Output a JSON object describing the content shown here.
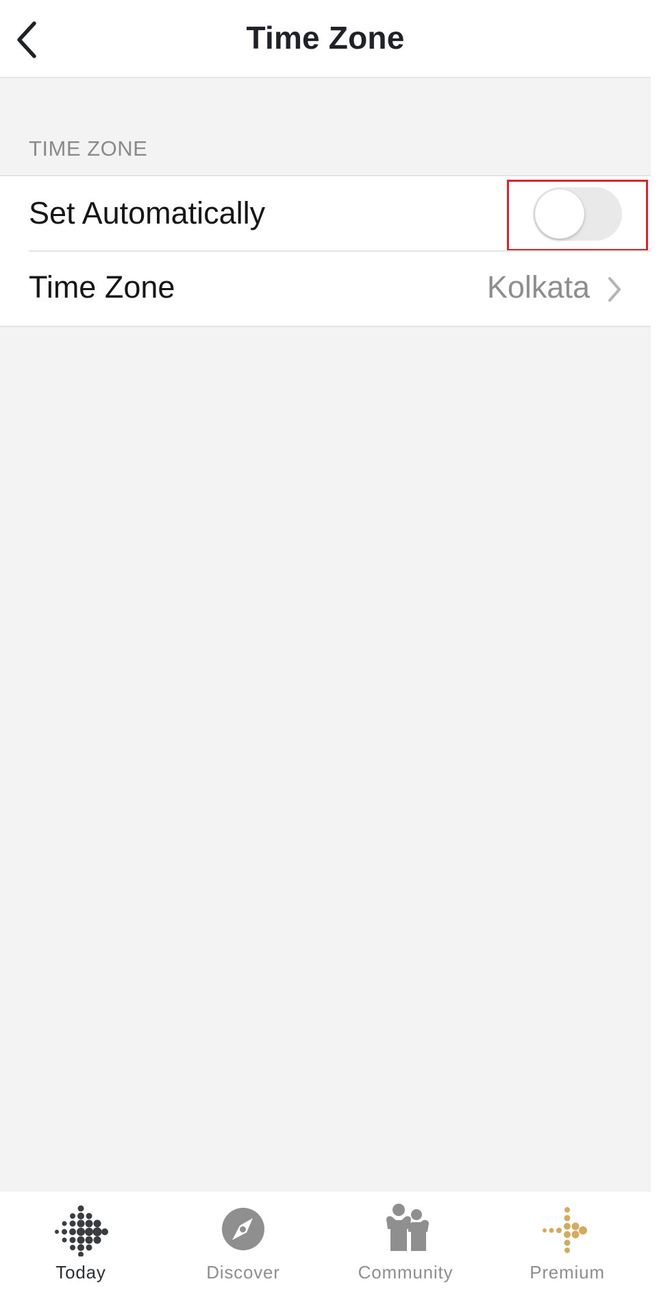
{
  "header": {
    "title": "Time Zone",
    "back_icon": "chevron-left-icon"
  },
  "section": {
    "title": "TIME ZONE"
  },
  "settings": {
    "set_automatically": {
      "label": "Set Automatically",
      "enabled": false
    },
    "time_zone": {
      "label": "Time Zone",
      "value": "Kolkata",
      "icon": "chevron-right-icon"
    }
  },
  "tab_bar": {
    "tabs": [
      {
        "label": "Today",
        "icon": "today-dots-icon",
        "active": true
      },
      {
        "label": "Discover",
        "icon": "compass-icon",
        "active": false
      },
      {
        "label": "Community",
        "icon": "community-icon",
        "active": false
      },
      {
        "label": "Premium",
        "icon": "premium-icon",
        "active": false
      }
    ]
  },
  "colors": {
    "background": "#f3f3f3",
    "surface": "#ffffff",
    "title_text": "#1f2327",
    "secondary_text": "#8e8e8e",
    "highlight_border": "#d9232f",
    "toggle_off_track": "#e9e9ea",
    "premium_gold": "#d4aa5f"
  }
}
